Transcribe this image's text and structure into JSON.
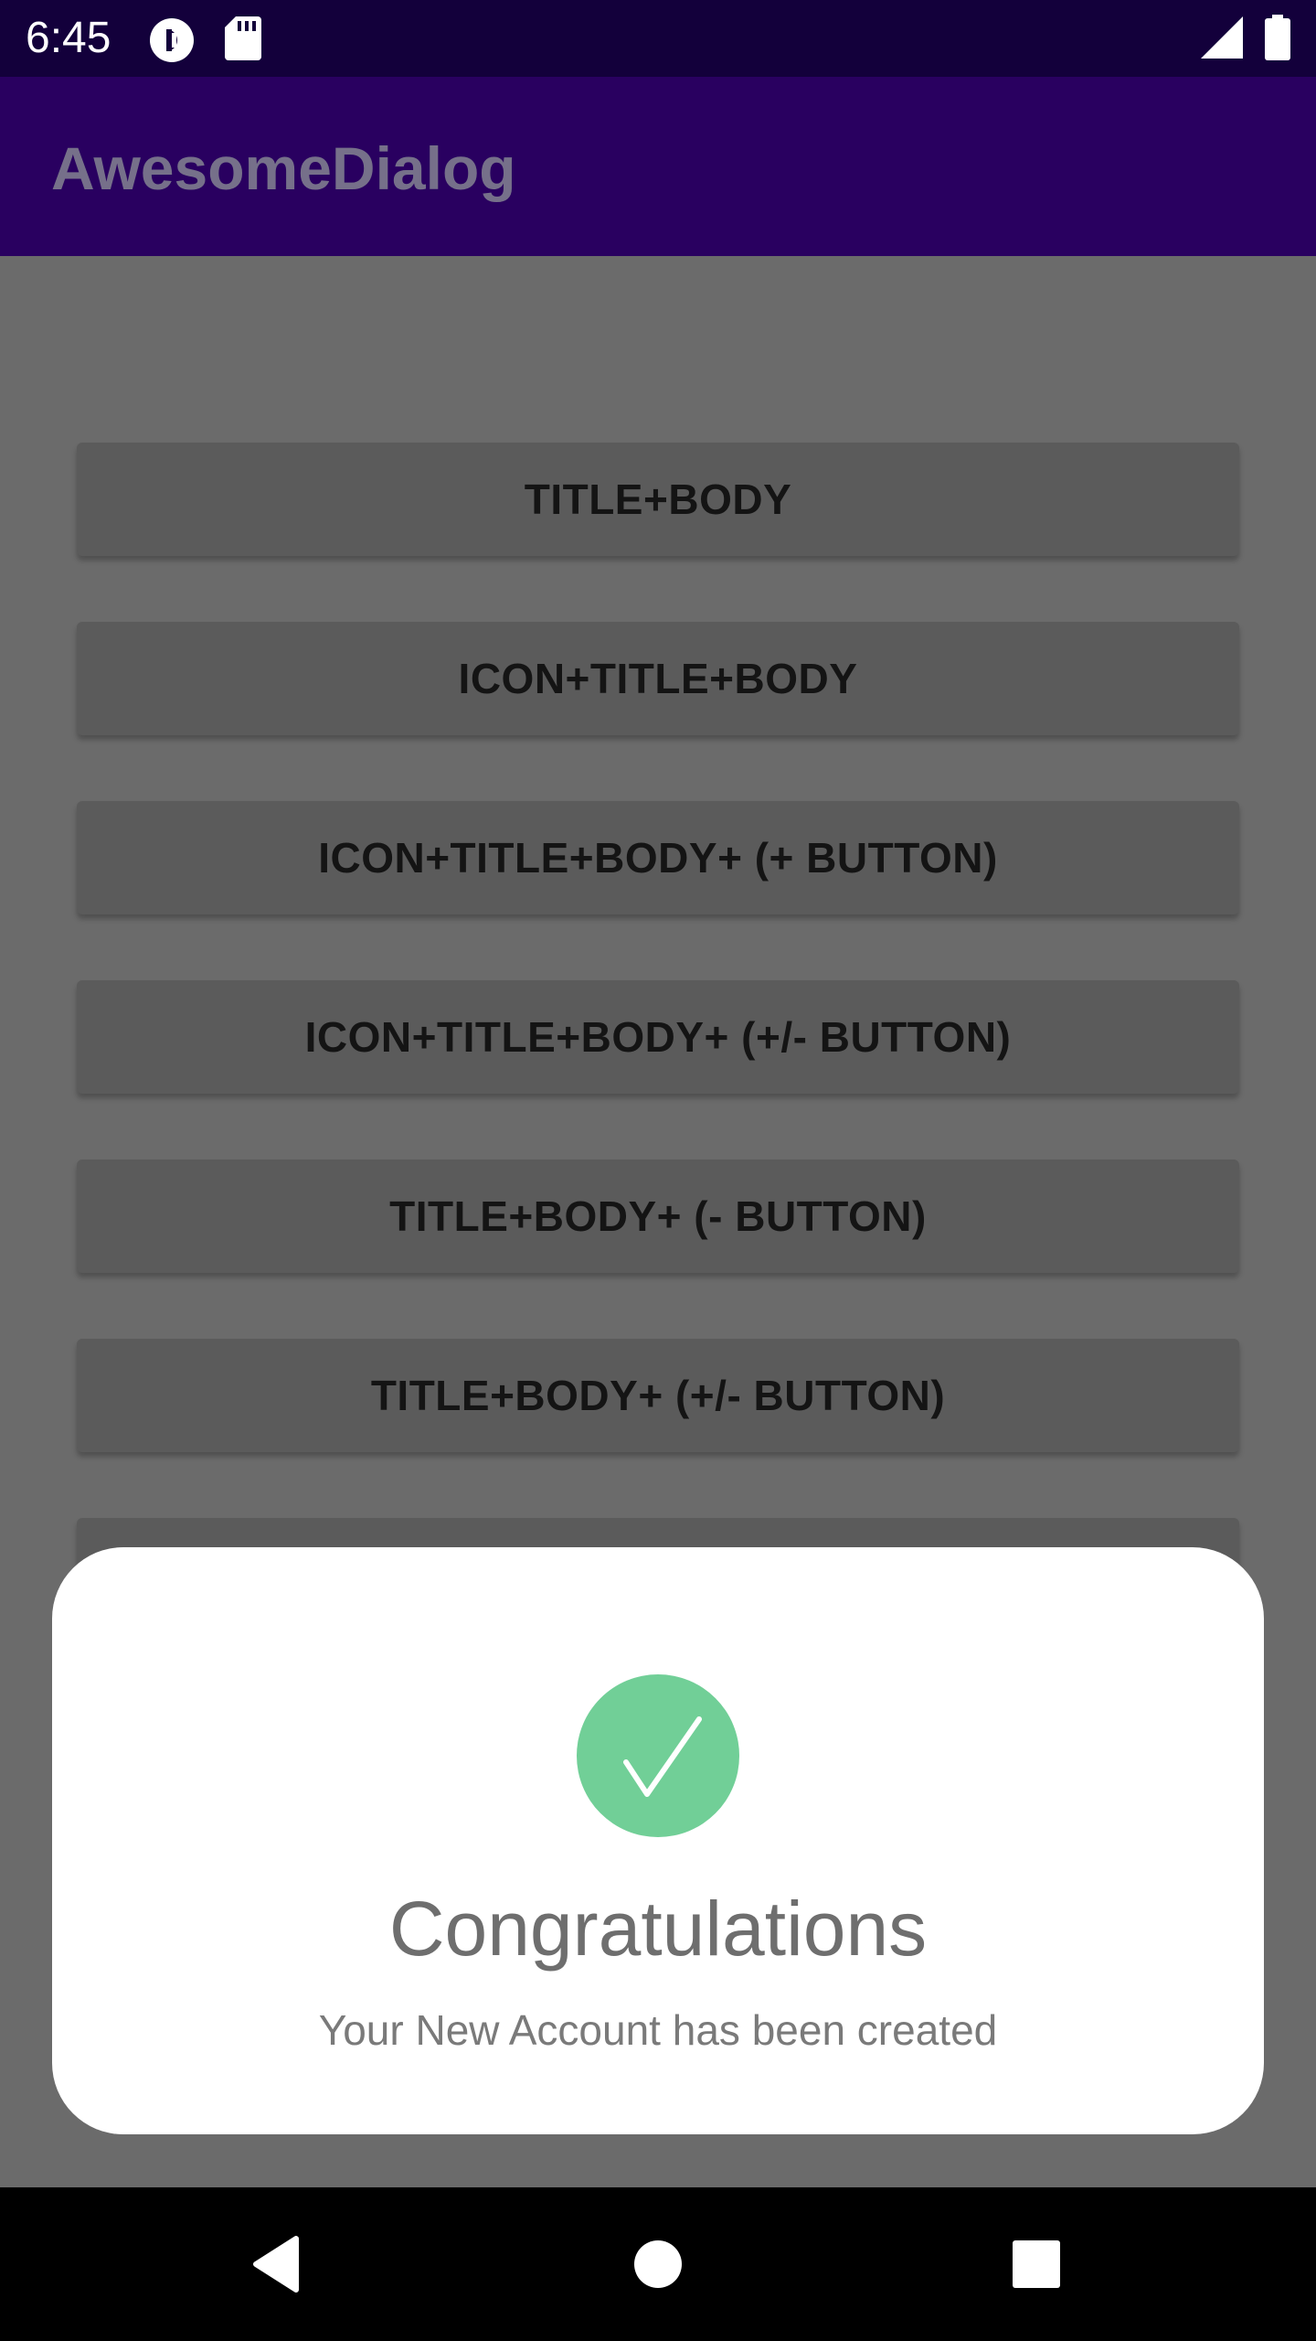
{
  "status_bar": {
    "time": "6:45",
    "icons": [
      "pocket-casts-icon",
      "sd-card-icon",
      "signal-icon",
      "battery-icon"
    ]
  },
  "app_bar": {
    "title": "AwesomeDialog"
  },
  "buttons": [
    {
      "label": "TITLE+BODY"
    },
    {
      "label": "ICON+TITLE+BODY"
    },
    {
      "label": "ICON+TITLE+BODY+ (+ BUTTON)"
    },
    {
      "label": "ICON+TITLE+BODY+ (+/- BUTTON)"
    },
    {
      "label": "TITLE+BODY+ (- BUTTON)"
    },
    {
      "label": "TITLE+BODY+ (+/- BUTTON)"
    },
    {
      "label": ""
    }
  ],
  "dialog": {
    "icon": "checkmark-icon",
    "title": "Congratulations",
    "body": "Your New Account has been created"
  },
  "nav_bar": {
    "icons": [
      "back-icon",
      "home-icon",
      "recents-icon"
    ]
  },
  "colors": {
    "status_bar": "#13003b",
    "app_bar": "#290060",
    "scrim_background": "#6b6b6b",
    "button": "#5b5b5b",
    "success": "#71cf97"
  }
}
